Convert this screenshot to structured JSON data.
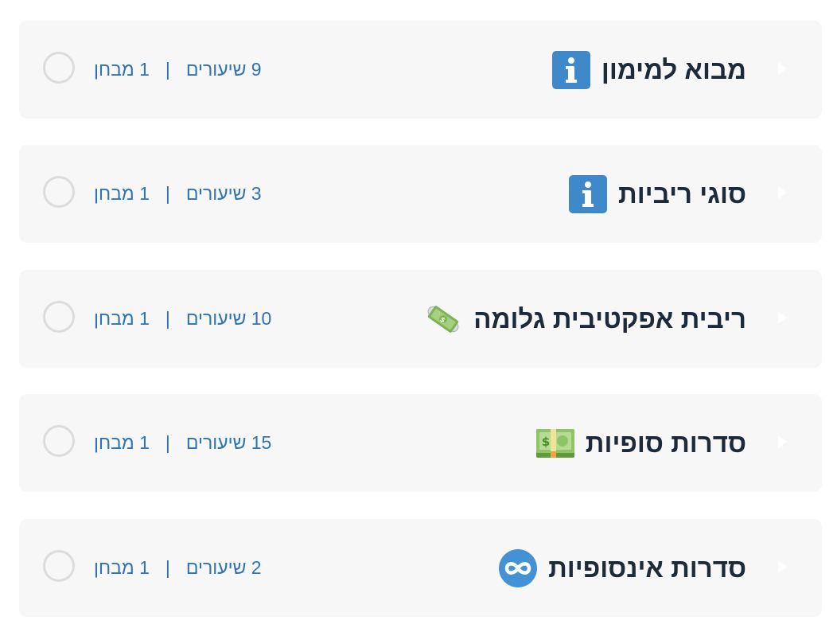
{
  "colors": {
    "card_bg": "#f7f7f7",
    "title": "#1d2a3a",
    "meta": "#2d73b5",
    "info_icon": "#3f88c9",
    "infinity_icon": "#4392d6",
    "money_green": "#6fae4b"
  },
  "sections": [
    {
      "icon": "info-icon",
      "title": "מבוא למימון",
      "lessons": "9 שיעורים",
      "separator": "|",
      "quizzes": "1 מבחן"
    },
    {
      "icon": "info-icon",
      "title": "סוגי ריביות",
      "lessons": "3 שיעורים",
      "separator": "|",
      "quizzes": "1 מבחן"
    },
    {
      "icon": "money-with-wings-icon",
      "title": "ריבית אפקטיבית גלומה",
      "lessons": "10 שיעורים",
      "separator": "|",
      "quizzes": "1 מבחן"
    },
    {
      "icon": "dollar-banknote-icon",
      "title": "סדרות סופיות",
      "lessons": "15 שיעורים",
      "separator": "|",
      "quizzes": "1 מבחן"
    },
    {
      "icon": "infinity-icon",
      "title": "סדרות אינסופיות",
      "lessons": "2 שיעורים",
      "separator": "|",
      "quizzes": "1 מבחן"
    }
  ]
}
